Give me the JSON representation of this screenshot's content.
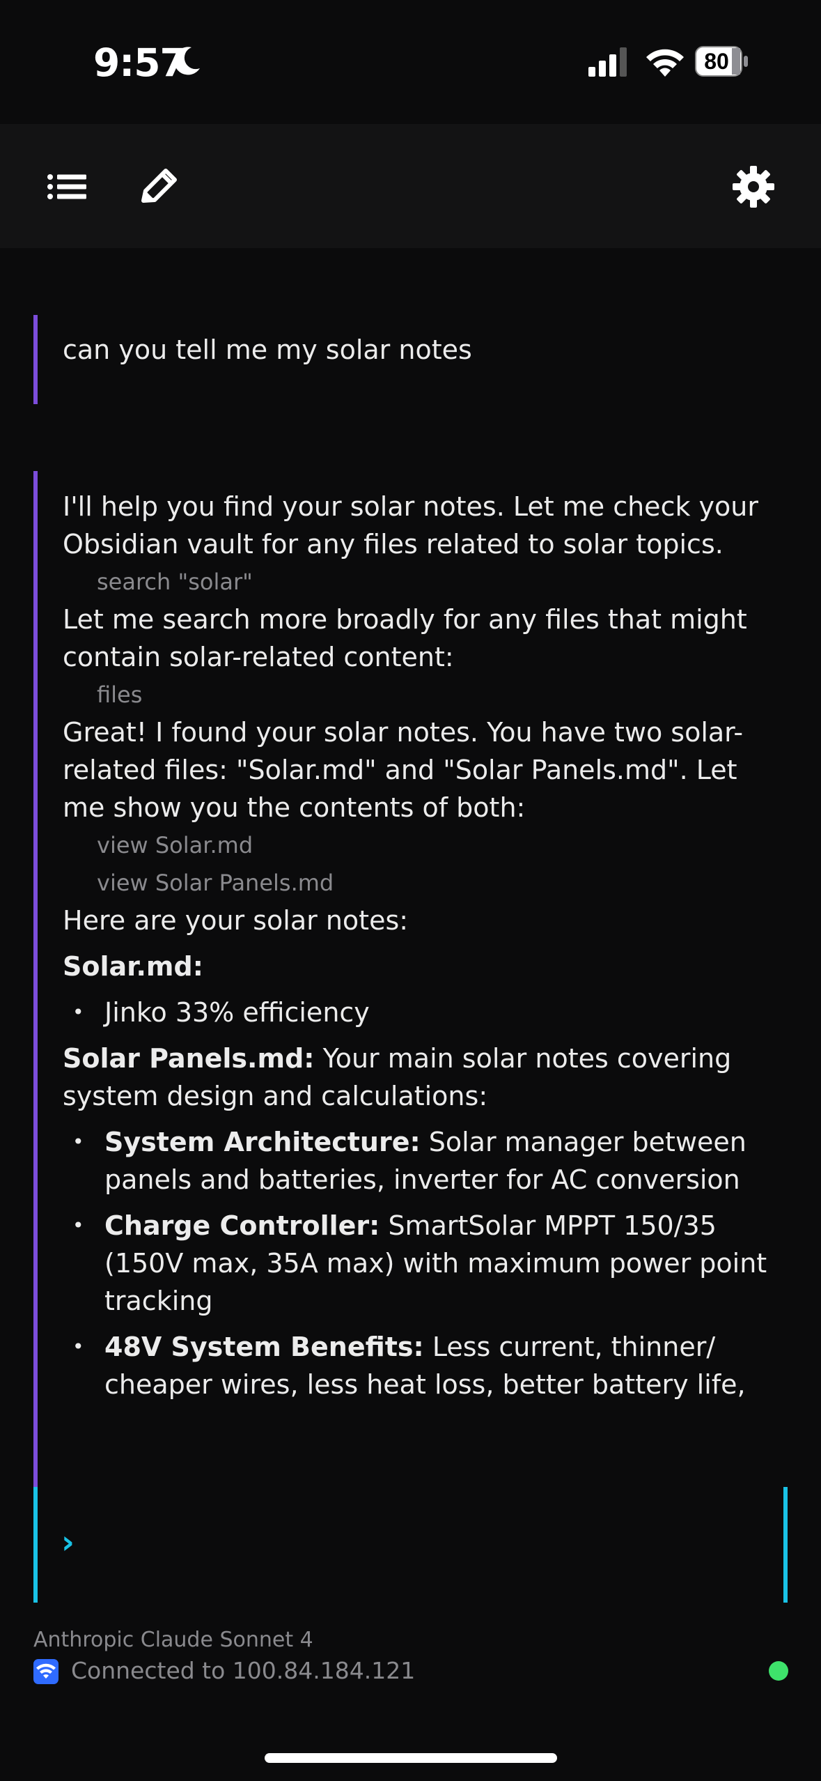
{
  "status_bar": {
    "time": "9:57",
    "battery_level": "80",
    "icons": [
      "moon-icon",
      "signal-icon",
      "wifi-icon",
      "battery-icon"
    ]
  },
  "toolbar": {
    "icons": [
      "list-icon",
      "edit-icon",
      "settings-icon"
    ]
  },
  "conversation": {
    "user_message": "can you tell me my solar notes",
    "assistant": {
      "p1": "I'll help you find your solar notes. Let me check your Obsidian vault for any files related to solar topics.",
      "tool1": "search \"solar\"",
      "p2": "Let me search more broadly for any files that might contain solar-related content:",
      "tool2": "files",
      "p3": "Great! I found your solar notes. You have two solar-related files: \"Solar.md\" and \"Solar Panels.md\". Let me show you the contents of both:",
      "tool3": "view Solar.md",
      "tool4": "view Solar Panels.md",
      "p4": "Here are your solar notes:",
      "h1": "Solar.md:",
      "bullet1": "Jinko 33% efficiency",
      "h2": "Solar Panels.md:",
      "h2_text": " Your main solar notes covering system design and calculations:",
      "items": [
        {
          "label": "System Architecture:",
          "text": " Solar manager between panels and batteries, inverter for AC conversion"
        },
        {
          "label": "Charge Controller:",
          "text": " SmartSolar MPPT 150/35 (150V max, 35A max) with maximum power point tracking"
        },
        {
          "label": "48V System Benefits:",
          "text": " Less current, thinner/ cheaper wires, less heat loss, better battery life,"
        }
      ]
    }
  },
  "input": {
    "prompt_symbol": "›",
    "value": ""
  },
  "footer": {
    "model": "Anthropic Claude Sonnet 4",
    "connection": "Connected to 100.84.184.121",
    "status_color": "#3ee26b"
  },
  "colors": {
    "accent_purple": "#7c4ddb",
    "accent_cyan": "#19c2e6",
    "background": "#0b0b0c"
  }
}
